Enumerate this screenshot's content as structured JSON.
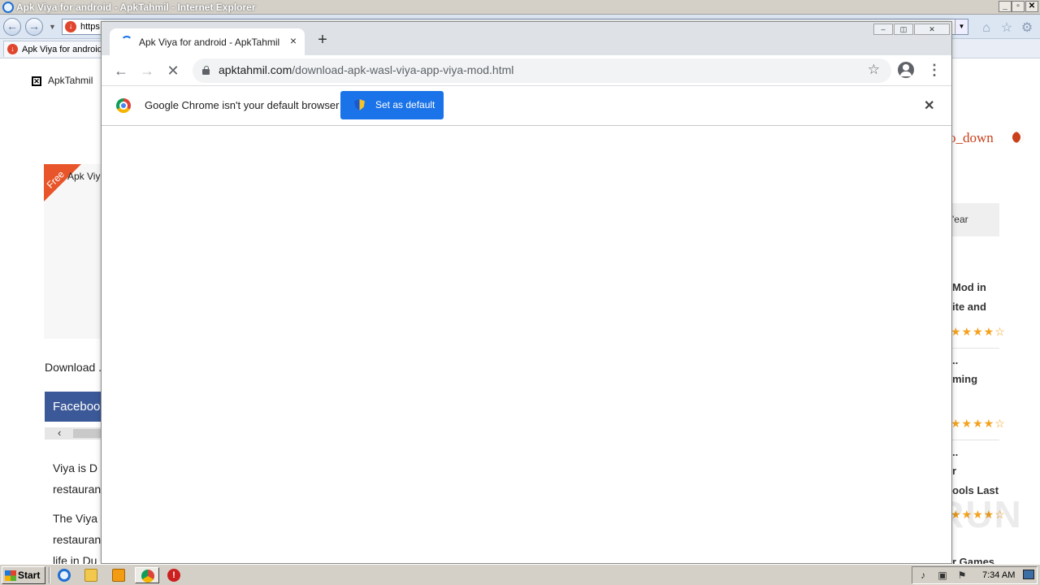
{
  "ie": {
    "title": "Apk Viya for android - ApkTahmil - Internet Explorer",
    "address_text": "https",
    "tab_title": "Apk Viya for android - ApkTahmil",
    "site_name": "ApkTahmil",
    "free_label": "Free",
    "app_card_name": "Apk Viya",
    "download_text": "Download .",
    "facebook_label": "Faceboo",
    "article_lines": [
      "Viya is D",
      "restauran",
      "The Viya",
      "restauran",
      "life in Du"
    ],
    "right_link": "o_down",
    "right_year": "'ear",
    "right_lines": [
      "Mod in",
      "ite and",
      "..",
      "ming",
      "..",
      "r",
      "ools Last",
      "r Games"
    ],
    "watermark": "ANY RUN"
  },
  "chrome": {
    "tab_title": "Apk Viya for android - ApkTahmil",
    "tab_close": "×",
    "new_tab": "+",
    "url_host": "apktahmil.com",
    "url_path": "/download-apk-wasl-viya-app-viya-mod.html",
    "infobar_message": "Google Chrome isn't your default browser",
    "set_default_label": "Set as default",
    "infobar_close": "✕"
  },
  "taskbar": {
    "start_label": "Start",
    "clock": "7:34 AM"
  }
}
